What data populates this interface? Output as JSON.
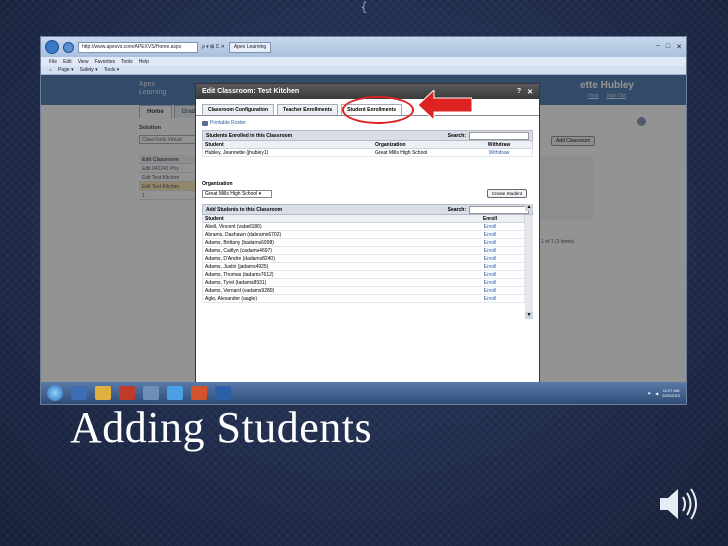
{
  "slide": {
    "ornament": "{",
    "title": "Adding Students"
  },
  "browser": {
    "address": "http://www.apexvs.com/APEXVS/Home.aspx",
    "address_controls": "ρ ▾ ⊠ C ✕",
    "tab_label": "Apex Learning",
    "menu": [
      "File",
      "Edit",
      "View",
      "Favorites",
      "Tools",
      "Help"
    ],
    "commands": [
      "Page ▾",
      "Safety ▾",
      "Tools ▾"
    ]
  },
  "apex_page": {
    "logo_line1": "Apex",
    "logo_line2": "Learning",
    "user_name": "ette Hubley",
    "links": [
      "Help",
      "Sign Out"
    ],
    "tabs": [
      "Home",
      "Grade"
    ],
    "solution_label": "Solution",
    "solution_value": "ClassTools Virtual",
    "add_classroom_button": "Add Classroom",
    "bg_rows": [
      {
        "text": "Edit  Classroom"
      },
      {
        "text": "Edit  041241 Phy"
      },
      {
        "text": "Edit  Test Kitchen"
      },
      {
        "text": "Edit  Test Kitchen"
      },
      {
        "text": "1"
      }
    ],
    "pager": "1 of 1 (3 items)"
  },
  "dialog": {
    "title": "Edit Classroom: Test Kitchen",
    "help_glyph": "?",
    "close_glyph": "✕",
    "tabs": [
      "Classroom Configuration",
      "Teacher Enrollments",
      "Student Enrollments"
    ],
    "printable_roster": "Printable Roster",
    "enrolled_section": "Students Enrolled in this Classroom",
    "search_label": "Search:",
    "enrolled_headers": {
      "student": "Student",
      "organization": "Organization",
      "withdraw": "Withdraw"
    },
    "enrolled_rows": [
      {
        "student": "Hubley, Jeannette (jhubley1)",
        "organization": "Great Mills High School",
        "withdraw": "Withdraw"
      }
    ],
    "organization_label": "Organization",
    "organization_value": "Great Mills High School",
    "create_student_button": "Create Student",
    "add_section": "Add Students to this Classroom",
    "add_headers": {
      "student": "Student",
      "enroll": "Enroll"
    },
    "add_rows": [
      {
        "student": "Abell, Vincent (vabell186)",
        "enroll": "Enroll"
      },
      {
        "student": "Abrams, Dashawn (dabrams6702)",
        "enroll": "Enroll"
      },
      {
        "student": "Adams, Brittany (badams6998)",
        "enroll": "Enroll"
      },
      {
        "student": "Adams, Caitlyn (cadams4697)",
        "enroll": "Enroll"
      },
      {
        "student": "Adams, D'Andre (dadams8240)",
        "enroll": "Enroll"
      },
      {
        "student": "Adams, Justin (jadams4925)",
        "enroll": "Enroll"
      },
      {
        "student": "Adams, Thomas (tadams7612)",
        "enroll": "Enroll"
      },
      {
        "student": "Adams, Tyrel (tadams8931)",
        "enroll": "Enroll"
      },
      {
        "student": "Adams, Vernard (vadams9280)",
        "enroll": "Enroll"
      },
      {
        "student": "Agle, Alexander (aagle)",
        "enroll": "Enroll"
      }
    ]
  },
  "taskbar": {
    "time": "11:27 AM",
    "date": "2/20/2012"
  },
  "colors": {
    "slide_bg": "#1e2a4a",
    "highlight": "#dd2222",
    "apex_header": "#3c6ea8"
  }
}
